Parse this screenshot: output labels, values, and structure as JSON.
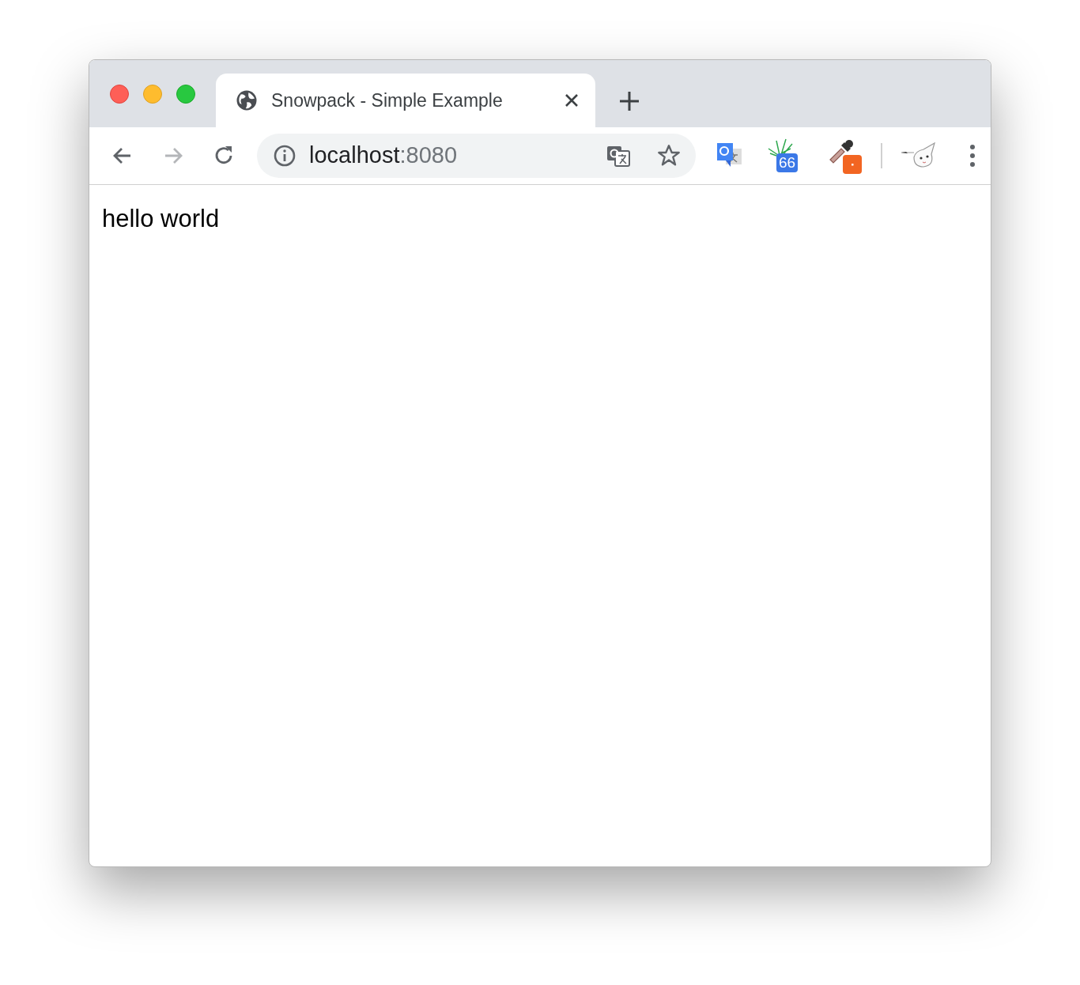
{
  "tabs": [
    {
      "title": "Snowpack - Simple Example",
      "selected": true
    }
  ],
  "nav": [
    {
      "kind": "back",
      "disabled": false
    },
    {
      "kind": "forward",
      "disabled": true
    },
    {
      "kind": "reload",
      "disabled": false
    }
  ],
  "address": {
    "host": "localhost",
    "port": ":8080"
  },
  "extensions": [
    {
      "kind": "translate"
    },
    {
      "kind": "burst",
      "badge": "66"
    },
    {
      "kind": "dropper"
    },
    {
      "kind": "divider"
    },
    {
      "kind": "mascot"
    }
  ],
  "page": {
    "text": "hello world"
  }
}
